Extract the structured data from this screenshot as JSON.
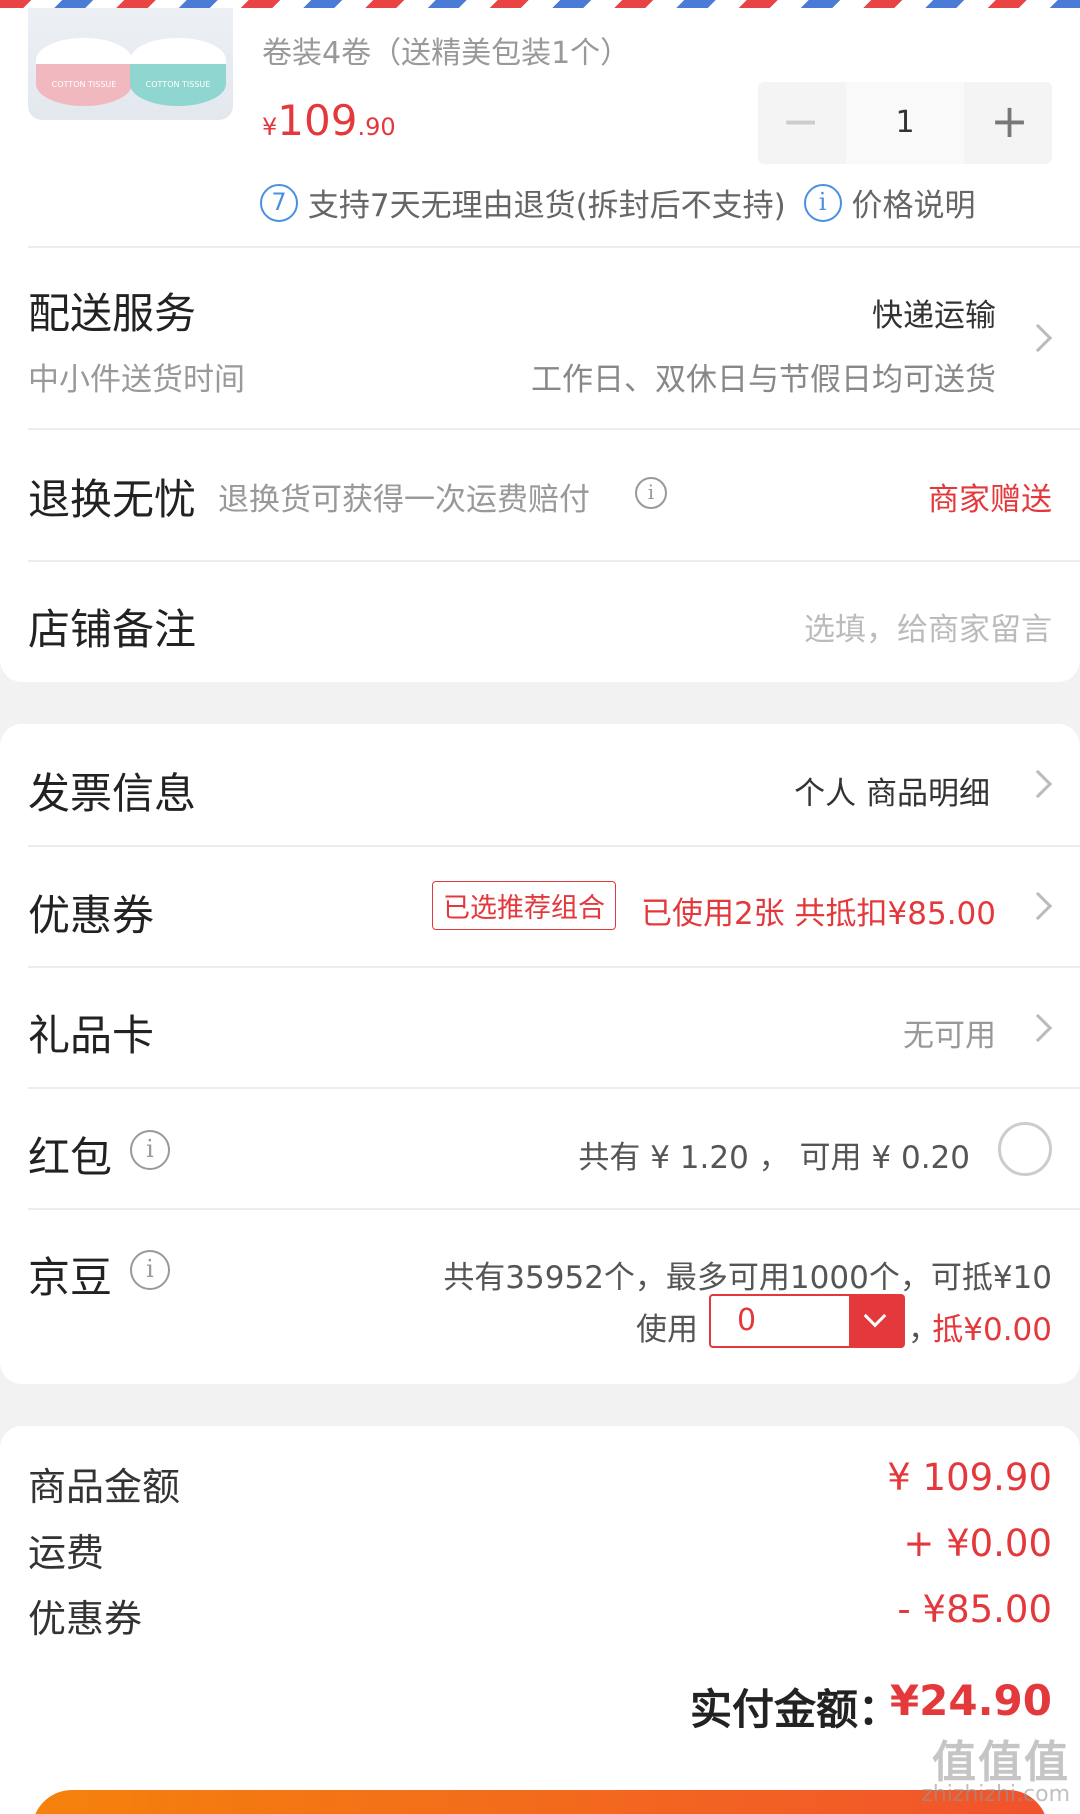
{
  "product": {
    "spec": "卷装4卷（送精美包装1个）",
    "price_currency": "¥",
    "price_int": "109",
    "price_dec": ".90",
    "quantity": "1",
    "minus": "−",
    "plus": "+",
    "thumb_text_left": "COTTON TISSUE",
    "thumb_text_right": "COTTON TISSUE",
    "return_icon": "7",
    "return_policy": "支持7天无理由退货(拆封后不支持)",
    "price_info_icon": "i",
    "price_explain": "价格说明"
  },
  "delivery": {
    "label": "配送服务",
    "method": "快递运输",
    "time_label": "中小件送货时间",
    "time_value": "工作日、双休日与节假日均可送货"
  },
  "returns": {
    "label": "退换无忧",
    "desc": "退换货可获得一次运费赔付",
    "info_icon": "i",
    "value": "商家赠送"
  },
  "remark": {
    "label": "店铺备注",
    "placeholder": "选填，给商家留言"
  },
  "invoice": {
    "label": "发票信息",
    "value": "个人 商品明细"
  },
  "coupon": {
    "label": "优惠券",
    "tag": "已选推荐组合",
    "value": "已使用2张 共抵扣¥85.00"
  },
  "giftcard": {
    "label": "礼品卡",
    "value": "无可用"
  },
  "redpacket": {
    "label": "红包",
    "info_icon": "i",
    "value": "共有 ¥ 1.20 ， 可用 ¥ 0.20"
  },
  "jingdou": {
    "label": "京豆",
    "info_icon": "i",
    "summary": "共有35952个，最多可用1000个，可抵¥10",
    "use_label": "使用",
    "use_value": "0",
    "comma": "，",
    "deduct": "抵¥0.00"
  },
  "summary": {
    "goods_label": "商品金额",
    "goods_value": "¥ 109.90",
    "shipping_label": "运费",
    "shipping_value": "+ ¥0.00",
    "coupon_label": "优惠券",
    "coupon_value": "- ¥85.00"
  },
  "footer": {
    "total_label": "实付金额：",
    "total_value": "¥24.90",
    "watermark": "值值值",
    "watermark_url": "zhizhizhi.com"
  },
  "colors": {
    "accent_red": "#e4393c",
    "info_blue": "#4a90e2",
    "button_orange": "#f5820b"
  }
}
